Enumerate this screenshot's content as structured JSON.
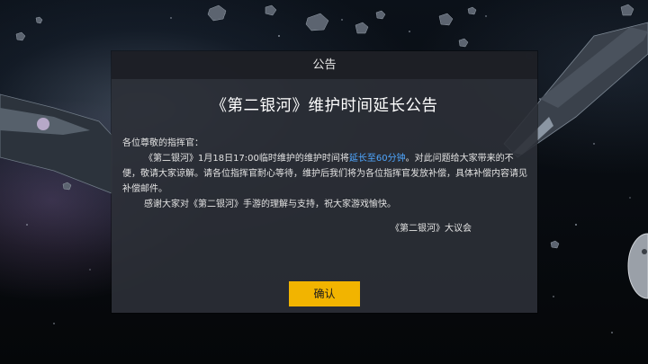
{
  "dialog": {
    "header": "公告",
    "title": "《第二银河》维护时间延长公告",
    "greeting": "各位尊敬的指挥官：",
    "para1_before": "《第二银河》1月18日17:00临时维护的维护时间将",
    "para1_highlight": "延长至60分钟",
    "para1_after": "。对此问题给大家带来的不便，敬请大家谅解。请各位指挥官耐心等待，维护后我们将为各位指挥官发放补偿，具体补偿内容请见补偿邮件。",
    "para2": "感谢大家对《第二银河》手游的理解与支持，祝大家游戏愉快。",
    "signature": "《第二银河》大议会",
    "confirm_label": "确认"
  },
  "colors": {
    "highlight": "#4fa7ff",
    "button": "#f2b400"
  }
}
